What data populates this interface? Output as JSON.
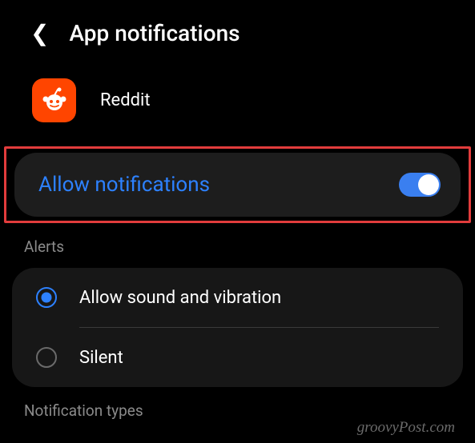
{
  "header": {
    "title": "App notifications"
  },
  "app": {
    "name": "Reddit"
  },
  "allow_notifications": {
    "label": "Allow notifications",
    "enabled": true
  },
  "sections": {
    "alerts_header": "Alerts",
    "notification_types_header": "Notification types"
  },
  "alerts": {
    "options": [
      {
        "label": "Allow sound and vibration",
        "selected": true
      },
      {
        "label": "Silent",
        "selected": false
      }
    ]
  },
  "watermark": "groovyPost.com"
}
